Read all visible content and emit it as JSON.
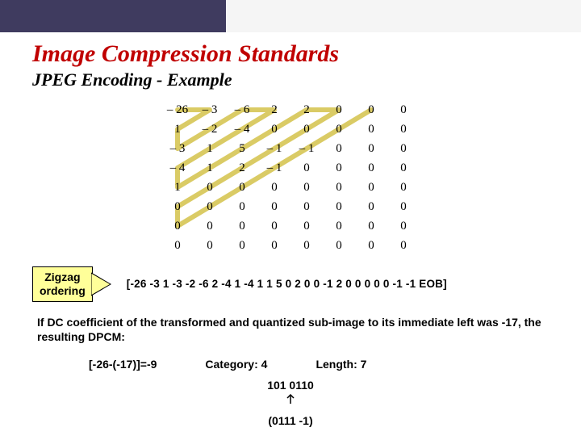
{
  "title": "Image Compression Standards",
  "subtitle": "JPEG Encoding - Example",
  "matrix": [
    [
      "– 26",
      "– 3",
      "– 6",
      "2",
      "2",
      "0",
      "0",
      "0"
    ],
    [
      "1",
      "– 2",
      "– 4",
      "0",
      "0",
      "0",
      "0",
      "0"
    ],
    [
      "– 3",
      "1",
      "5",
      "– 1",
      "– 1",
      "0",
      "0",
      "0"
    ],
    [
      "– 4",
      "1",
      "2",
      "– 1",
      "0",
      "0",
      "0",
      "0"
    ],
    [
      "1",
      "0",
      "0",
      "0",
      "0",
      "0",
      "0",
      "0"
    ],
    [
      "0",
      "0",
      "0",
      "0",
      "0",
      "0",
      "0",
      "0"
    ],
    [
      "0",
      "0",
      "0",
      "0",
      "0",
      "0",
      "0",
      "0"
    ],
    [
      "0",
      "0",
      "0",
      "0",
      "0",
      "0",
      "0",
      "0"
    ]
  ],
  "zigzag_label_l1": "Zigzag",
  "zigzag_label_l2": "ordering",
  "sequence": "[-26 -3 1 -3 -2  -6 2 -4 1 -4 1 1 5 0 2 0 0 -1 2 0 0 0 0 0 -1 -1 EOB]",
  "paragraph": "If DC coefficient of the transformed and quantized sub-image to its immediate left was -17, the resulting DPCM:",
  "dpcm_expr": "[-26-(-17)]=-9",
  "category": "Category: 4",
  "length": "Length: 7",
  "bits1": "101 0110",
  "bits2": "(0111 -1)"
}
